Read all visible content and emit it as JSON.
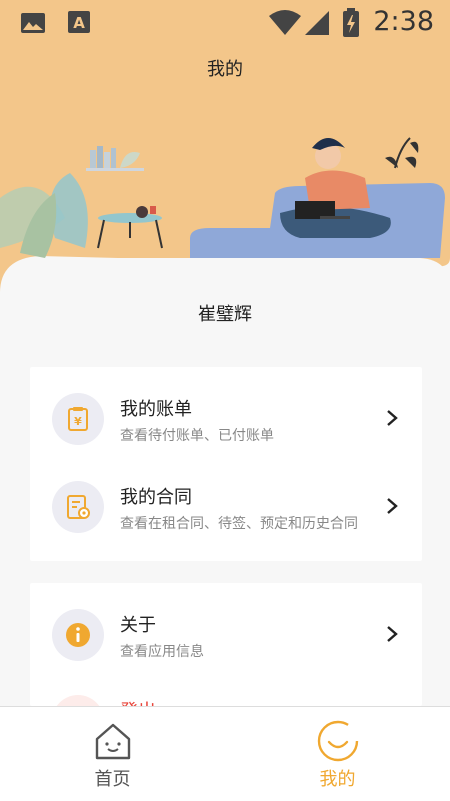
{
  "status_bar": {
    "time": "2:38",
    "icons": [
      "image-icon",
      "text-a-icon",
      "wifi-icon",
      "cellular-icon",
      "battery-charging-icon"
    ]
  },
  "header": {
    "title": "我的"
  },
  "profile": {
    "name": "崔璧辉"
  },
  "menu_card_1": [
    {
      "title": "我的账单",
      "subtitle": "查看待付账单、已付账单",
      "icon": "bill-icon"
    },
    {
      "title": "我的合同",
      "subtitle": "查看在租合同、待签、预定和历史合同",
      "icon": "contract-icon"
    }
  ],
  "menu_card_2": [
    {
      "title": "关于",
      "subtitle": "查看应用信息",
      "icon": "info-icon"
    },
    {
      "title": "登出",
      "icon": "logout-icon"
    }
  ],
  "tabbar": {
    "home_label": "首页",
    "mine_label": "我的"
  },
  "colors": {
    "header_bg": "#f3c68a",
    "accent": "#f0a830",
    "danger": "#e8443a",
    "text": "#222222",
    "subtext": "#888888"
  }
}
